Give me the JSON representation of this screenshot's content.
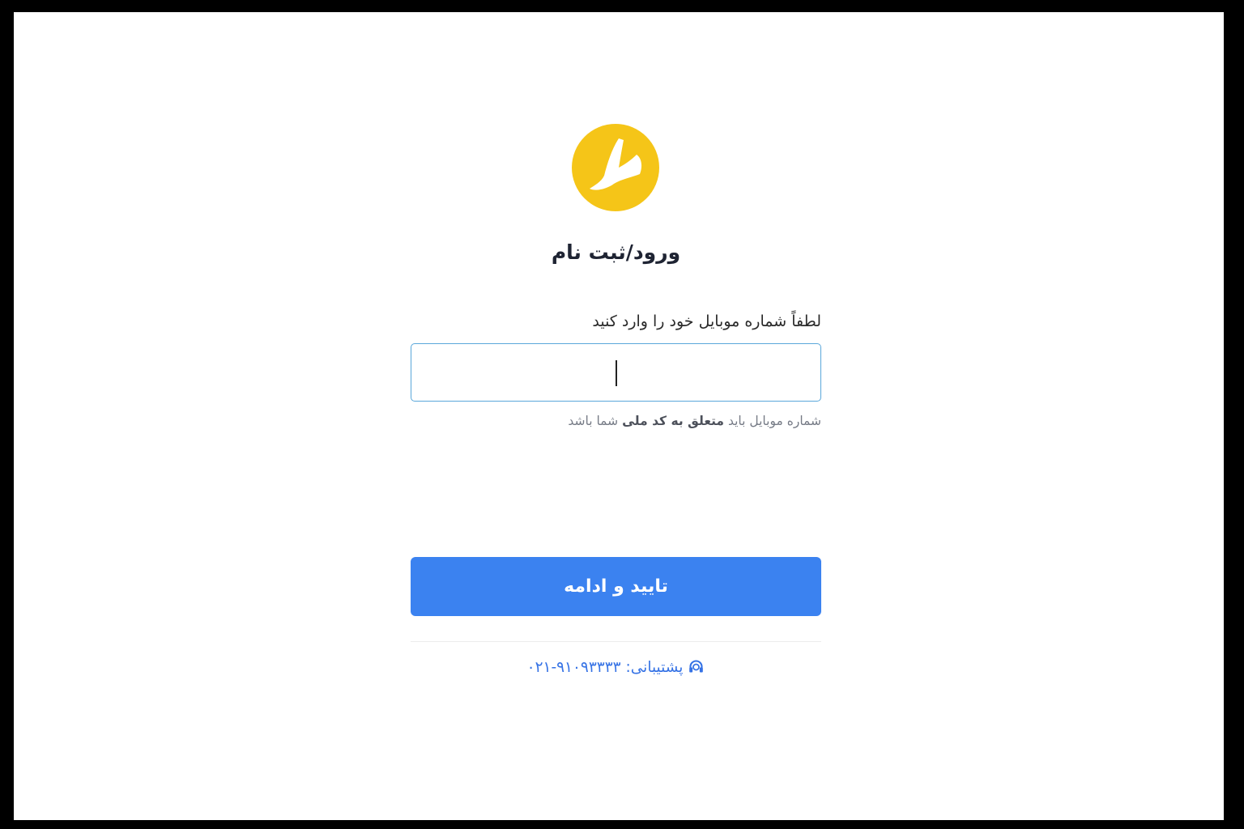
{
  "brand": {
    "logo_icon": "brand-logo-icon",
    "logo_color": "#F5C518"
  },
  "page": {
    "title": "ورود/ثبت نام"
  },
  "form": {
    "mobile_label": "لطفاً شماره موبایل خود را وارد کنید",
    "mobile_value": "",
    "hint_prefix": "شماره موبایل باید",
    "hint_bold": "متعلق به کد ملی",
    "hint_suffix": "شما باشد",
    "submit_label": "تایید و ادامه",
    "accent_color": "#3B82F0"
  },
  "support": {
    "icon": "headset-icon",
    "label": "پشتیبانی:",
    "phone": "۰۲۱-۹۱۰۹۳۳۳۳"
  }
}
